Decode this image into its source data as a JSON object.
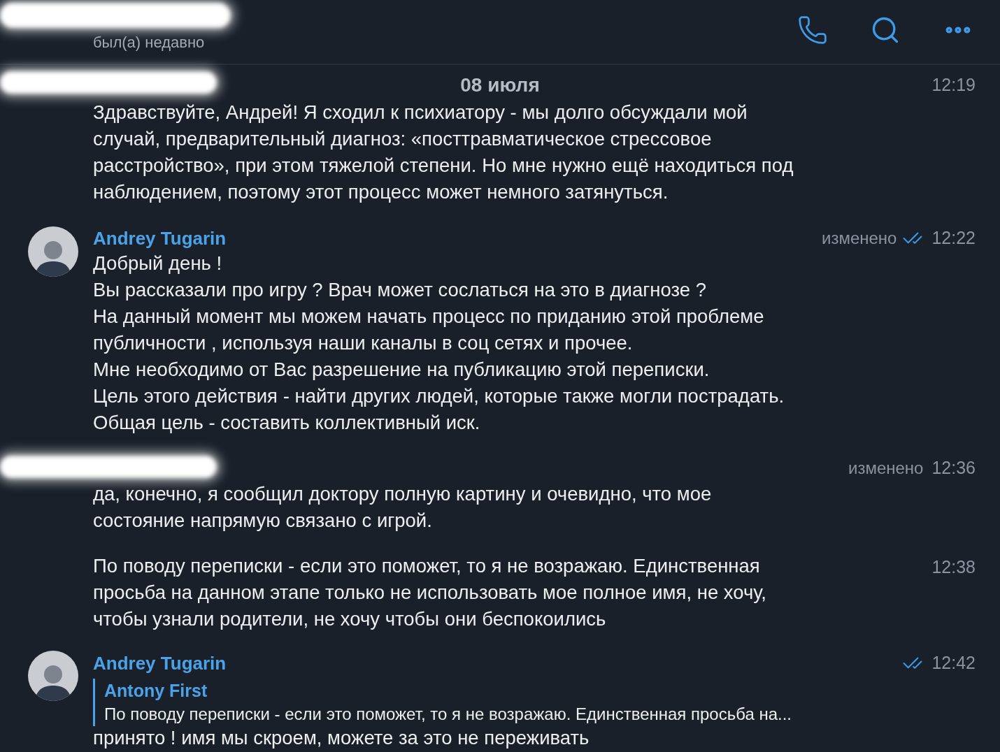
{
  "header": {
    "kind": "redacted",
    "status": "был(а) недавно"
  },
  "date_separator": "08 июля",
  "groups": [
    {
      "kind": "redacted",
      "entries": [
        {
          "time": "12:19",
          "lines": [
            "Здравствуйте, Андрей! Я сходил к психиатору - мы долго обсуждали мой",
            "случай, предварительный диагноз: «посттравматическое стрессовое",
            "расстройство», при этом тяжелой степени. Но мне нужно ещё находиться под",
            "наблюдением, поэтому этот процесс может немного затянуться."
          ]
        }
      ]
    },
    {
      "kind": "named",
      "sender": "Andrey Tugarin",
      "entries": [
        {
          "time": "12:22",
          "edited": "изменено",
          "read": true,
          "lines": [
            "Добрый день !",
            "Вы рассказали про игру ? Врач может сослаться на это в диагнозе ?",
            "На данный момент мы можем начать процесс по приданию этой проблеме",
            "публичности , используя наши каналы в соц сетях и прочее.",
            "Мне необходимо от Вас разрешение на публикацию этой переписки.",
            "Цель этого действия - найти других людей, которые также могли пострадать.",
            "Общая цель - составить коллективный иск."
          ]
        }
      ]
    },
    {
      "kind": "redacted",
      "entries": [
        {
          "time": "12:36",
          "edited": "изменено",
          "lines": [
            "да, конечно, я сообщил доктору полную картину и очевидно, что мое",
            "состояние напрямую связано с игрой."
          ]
        },
        {
          "time": "12:38",
          "lines": [
            "По поводу переписки - если это поможет, то я не возражаю. Единственная",
            "просьба на данном этапе только не использовать мое полное имя, не хочу,",
            "чтобы узнали родители, не хочу чтобы они беспокоились"
          ]
        }
      ]
    },
    {
      "kind": "named",
      "sender": "Andrey Tugarin",
      "entries": [
        {
          "time": "12:42",
          "read": true,
          "reply": {
            "author": "Antony First",
            "text": "По поводу переписки - если это поможет, то я не возражаю. Единственная просьба на..."
          },
          "lines": [
            "принято ! имя мы скроем, можете за это не переживать"
          ]
        }
      ]
    }
  ]
}
